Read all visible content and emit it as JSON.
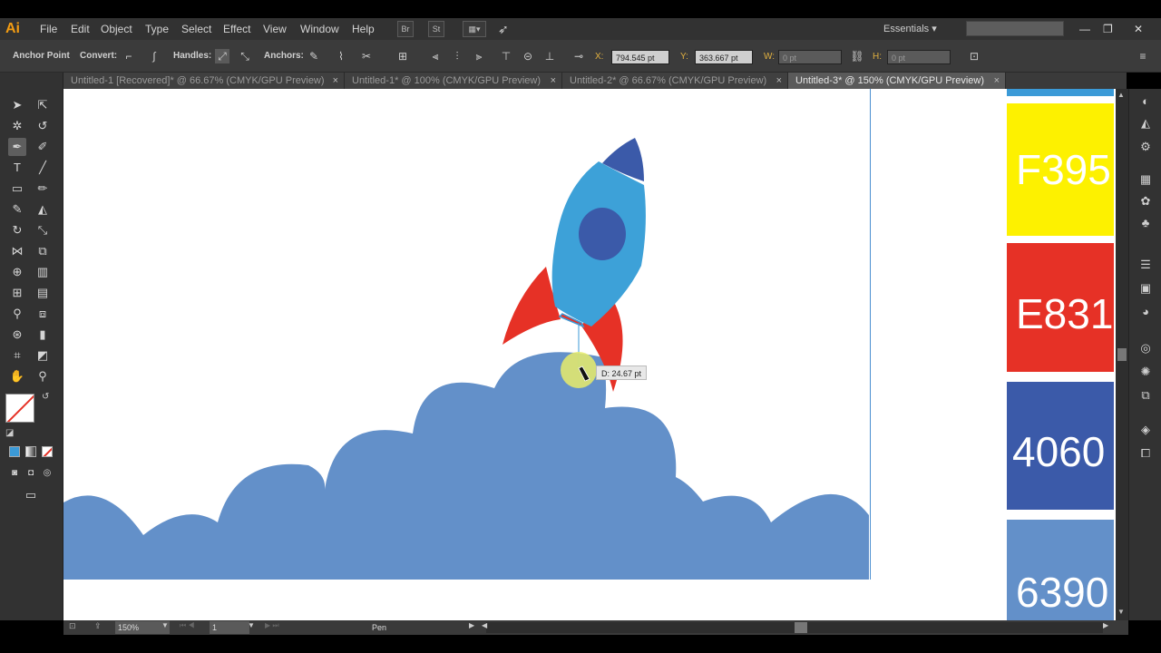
{
  "app": {
    "logo": "Ai"
  },
  "menu": [
    "File",
    "Edit",
    "Object",
    "Type",
    "Select",
    "Effect",
    "View",
    "Window",
    "Help"
  ],
  "menubar_icons": {
    "bridge": "Br",
    "stock": "St"
  },
  "workspace": "Essentials",
  "window_controls": {
    "minimize": "—",
    "restore": "❐",
    "close": "✕"
  },
  "control": {
    "anchor_point": "Anchor Point",
    "convert": "Convert:",
    "handles": "Handles:",
    "anchors": "Anchors:",
    "x_label": "X:",
    "x_value": "794.545 pt",
    "y_label": "Y:",
    "y_value": "363.667 pt",
    "w_label": "W:",
    "w_value": "0 pt",
    "h_label": "H:",
    "h_value": "0 pt"
  },
  "tabs": [
    {
      "label": "Untitled-1 [Recovered]* @ 66.67% (CMYK/GPU Preview)",
      "close": "×",
      "active": false
    },
    {
      "label": "Untitled-1* @ 100% (CMYK/GPU Preview)",
      "close": "×",
      "active": false
    },
    {
      "label": "Untitled-2* @ 66.67% (CMYK/GPU Preview)",
      "close": "×",
      "active": false
    },
    {
      "label": "Untitled-3* @ 150% (CMYK/GPU Preview)",
      "close": "×",
      "active": true
    }
  ],
  "swatches": [
    {
      "label": "F395",
      "color": "#fdf100"
    },
    {
      "label": "E831",
      "color": "#e63126"
    },
    {
      "label": "4060",
      "color": "#3b5aa9"
    },
    {
      "label": "6390",
      "color": "#6390c9"
    }
  ],
  "colors": {
    "sky_top": "#3b9ad7",
    "cloud": "#6390c9",
    "rocket_body": "#3da1d8",
    "rocket_accent": "#3b5aa9",
    "fins": "#e63126",
    "cursor_highlight": "#e8ec6a"
  },
  "tooltip": "D: 24.67 pt",
  "status": {
    "zoom": "150%",
    "page": "1",
    "tool": "Pen"
  }
}
